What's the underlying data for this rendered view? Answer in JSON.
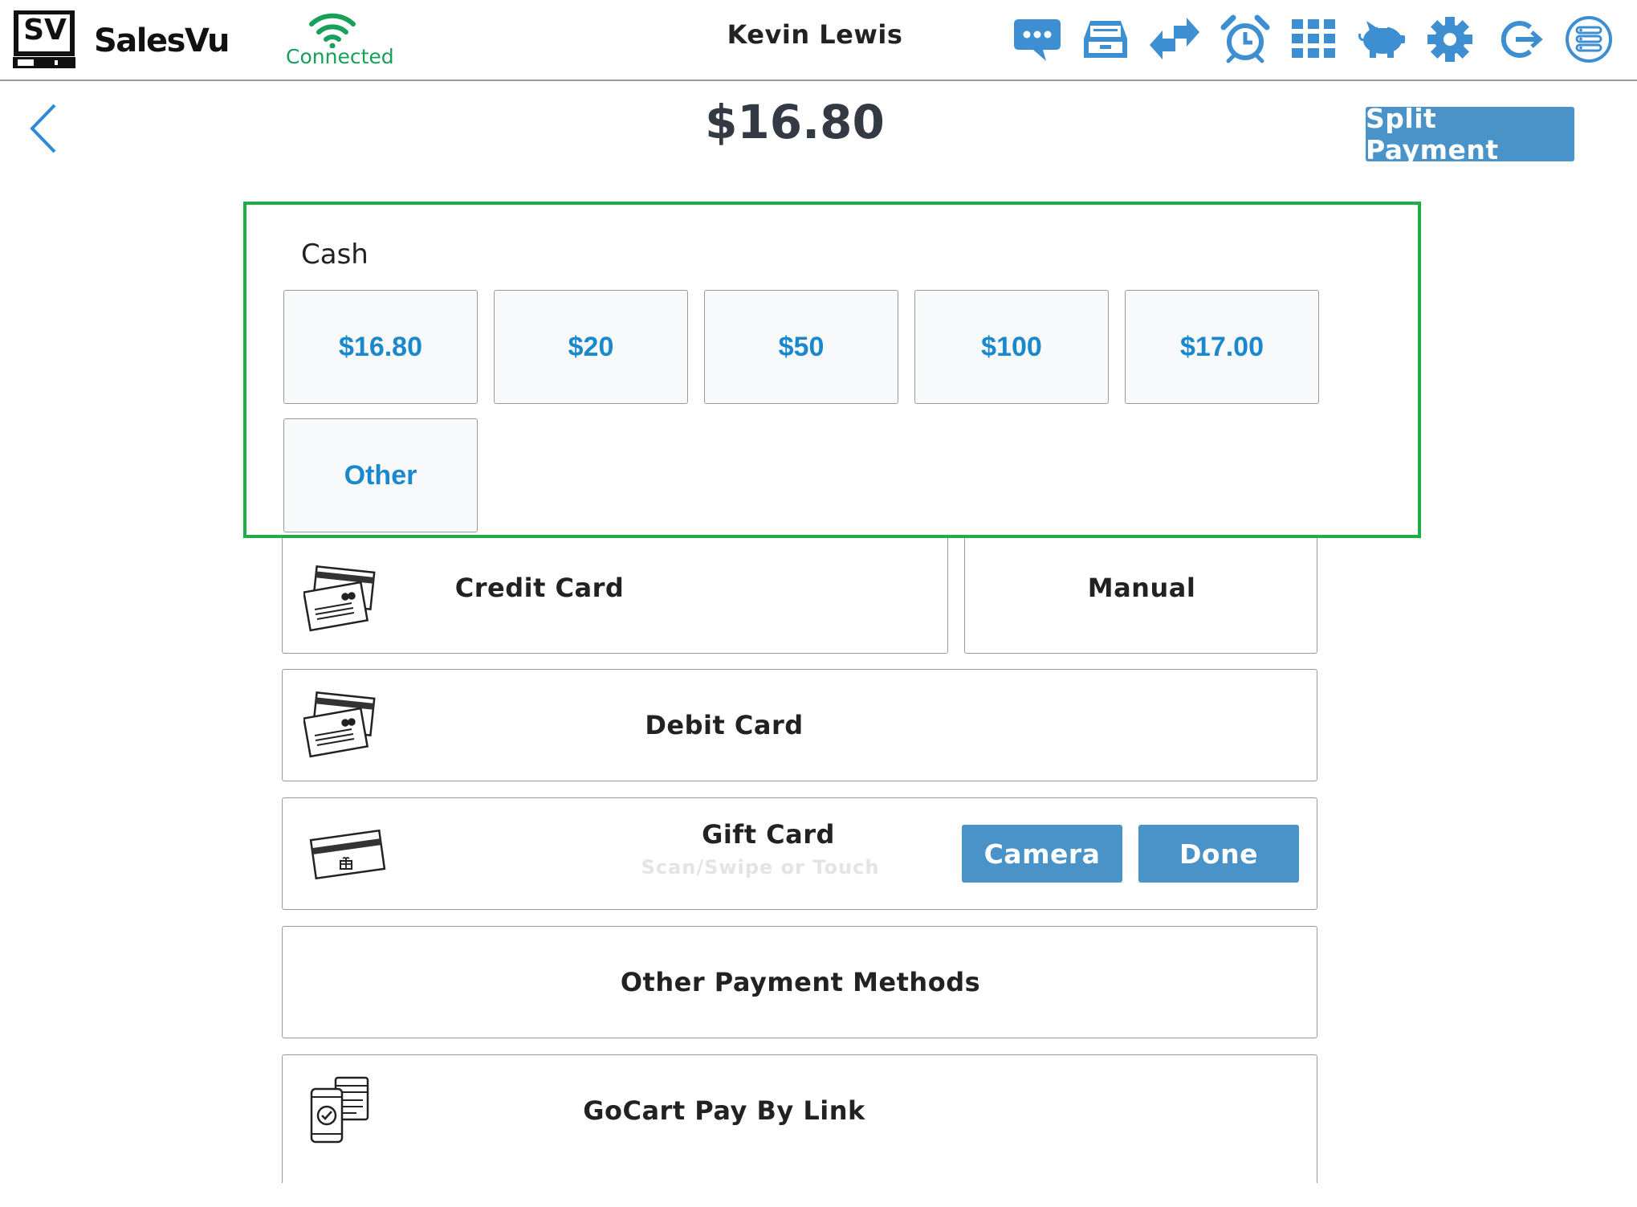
{
  "header": {
    "logo_badge": "SV",
    "brand": "SalesVu",
    "connection_status": "Connected",
    "user_name": "Kevin Lewis",
    "icons": [
      "chat-icon",
      "cash-drawer-icon",
      "transfer-icon",
      "alarm-clock-icon",
      "grid-menu-icon",
      "piggy-bank-icon",
      "settings-icon",
      "logout-icon",
      "list-menu-icon"
    ]
  },
  "payment": {
    "amount": "$16.80",
    "split_payment_label": "Split Payment"
  },
  "cash": {
    "title": "Cash",
    "options": [
      "$16.80",
      "$20",
      "$50",
      "$100",
      "$17.00",
      "Other"
    ]
  },
  "methods": {
    "credit_card": "Credit Card",
    "manual": "Manual",
    "debit_card": "Debit Card",
    "gift_card": "Gift Card",
    "gift_card_hint": "Scan/Swipe or Touch",
    "camera": "Camera",
    "done": "Done",
    "other_methods": "Other Payment Methods",
    "gocart": "GoCart Pay By Link"
  },
  "colors": {
    "accent_blue": "#4a93c9",
    "link_blue": "#1a88cc",
    "connected_green": "#17a05a",
    "highlight_green": "#1fae45"
  }
}
